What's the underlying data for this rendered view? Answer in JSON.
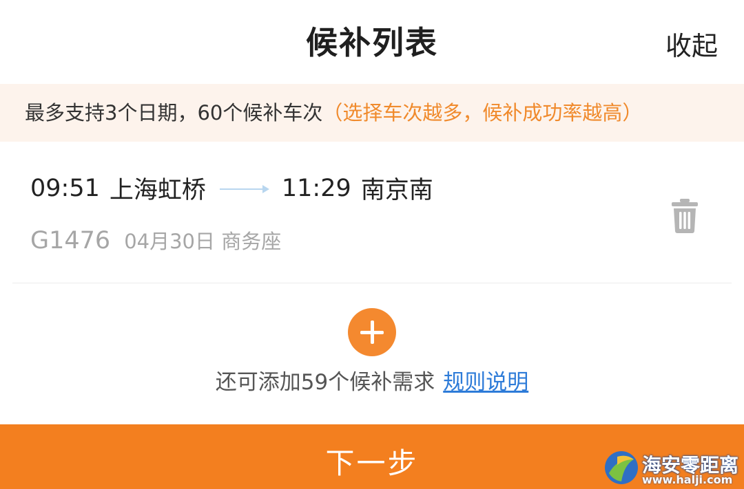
{
  "header": {
    "title": "候补列表",
    "collapse_label": "收起"
  },
  "notice": {
    "main": "最多支持3个日期，60个候补车次",
    "hint": "（选择车次越多，候补成功率越高）"
  },
  "trip": {
    "depart_time": "09:51",
    "depart_station": "上海虹桥",
    "arrive_time": "11:29",
    "arrive_station": "南京南",
    "train_no": "G1476",
    "date": "04月30日",
    "seat": "商务座",
    "delete_icon": "trash-icon"
  },
  "add": {
    "icon": "plus-icon",
    "remaining_text": "还可添加59个候补需求",
    "rules_link": "规则说明"
  },
  "footer": {
    "next_label": "下一步"
  },
  "watermark": {
    "name": "海安零距离",
    "url": "www.halji.com"
  },
  "colors": {
    "accent_orange": "#f37f1f",
    "hint_orange": "#f08a2c",
    "link_blue": "#2d7bd8",
    "notice_bg": "#fdf3ec",
    "muted_gray": "#a6a6a6"
  }
}
